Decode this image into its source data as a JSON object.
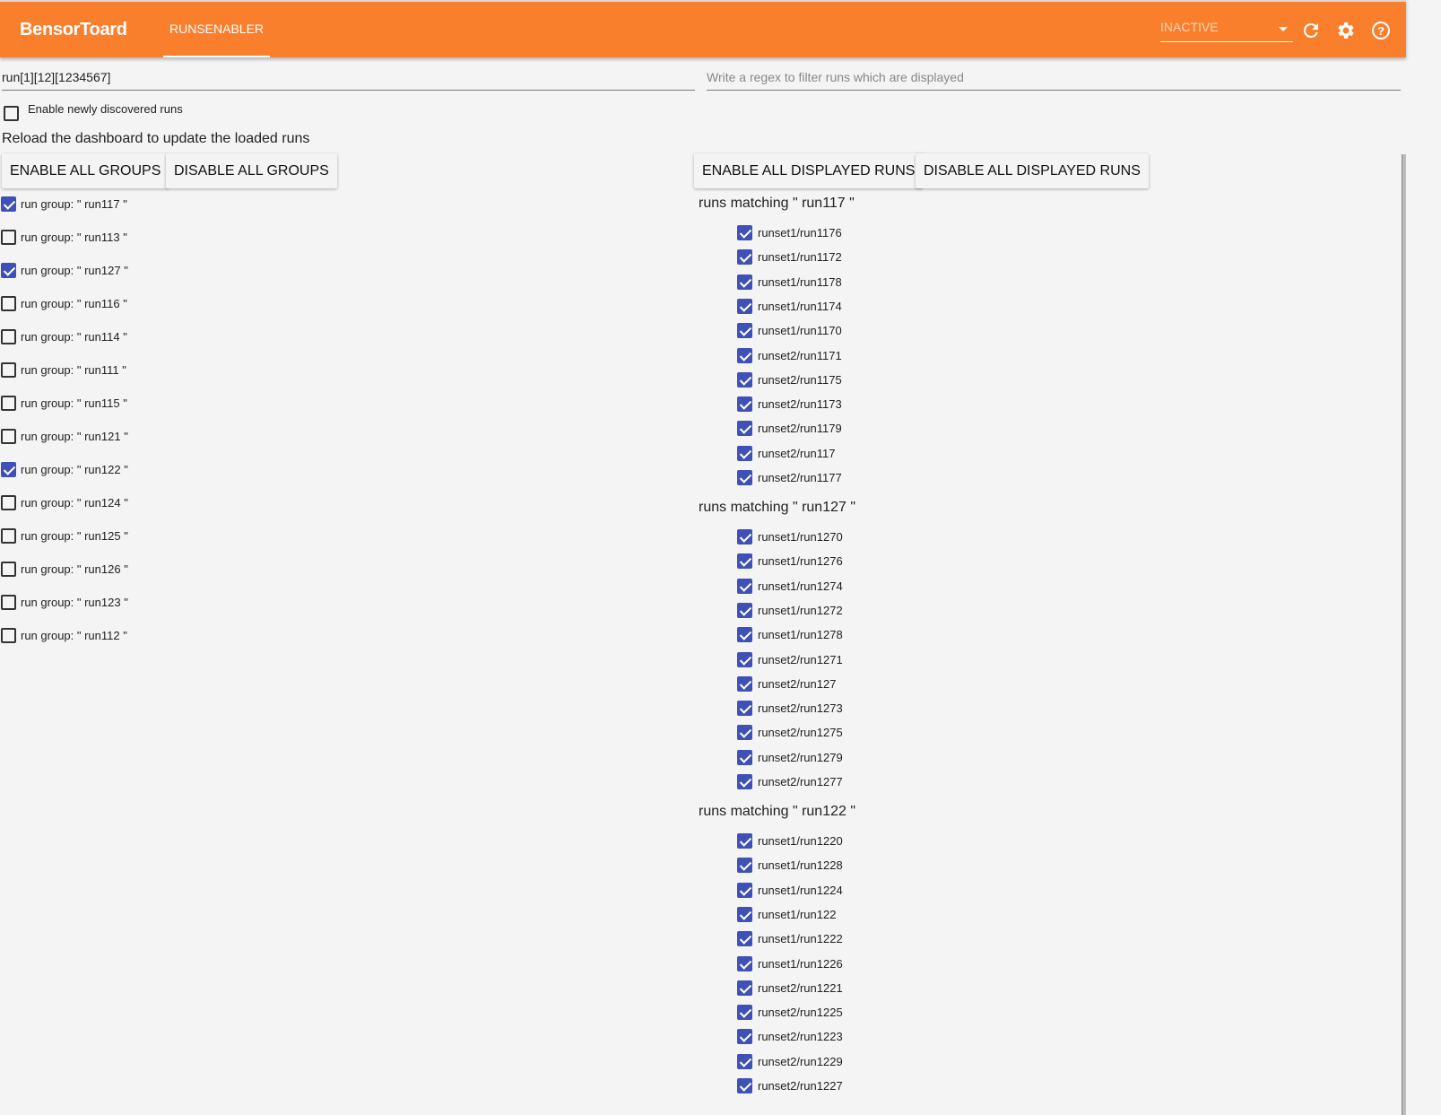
{
  "header": {
    "brand": "BensorToard",
    "tab": "RUNSENABLER",
    "status_select": "INACTIVE"
  },
  "filters": {
    "group_regex_value": "run[1][12][1234567]",
    "run_regex_placeholder": "Write a regex to filter runs which are displayed"
  },
  "enable_new_label": "Enable newly discovered runs",
  "reload_note": "Reload the dashboard to update the loaded runs",
  "buttons": {
    "enable_groups": "ENABLE ALL GROUPS",
    "disable_groups": "DISABLE ALL GROUPS",
    "enable_runs": "ENABLE ALL DISPLAYED RUNS",
    "disable_runs": "DISABLE ALL DISPLAYED RUNS"
  },
  "groups": [
    {
      "label": "run group: \" run117 \"",
      "checked": true
    },
    {
      "label": "run group: \" run113 \"",
      "checked": false
    },
    {
      "label": "run group: \" run127 \"",
      "checked": true
    },
    {
      "label": "run group: \" run116 \"",
      "checked": false
    },
    {
      "label": "run group: \" run114 \"",
      "checked": false
    },
    {
      "label": "run group: \" run111 \"",
      "checked": false
    },
    {
      "label": "run group: \" run115 \"",
      "checked": false
    },
    {
      "label": "run group: \" run121 \"",
      "checked": false
    },
    {
      "label": "run group: \" run122 \"",
      "checked": true
    },
    {
      "label": "run group: \" run124 \"",
      "checked": false
    },
    {
      "label": "run group: \" run125 \"",
      "checked": false
    },
    {
      "label": "run group: \" run126 \"",
      "checked": false
    },
    {
      "label": "run group: \" run123 \"",
      "checked": false
    },
    {
      "label": "run group: \" run112 \"",
      "checked": false
    }
  ],
  "run_sections": [
    {
      "heading": "runs matching \" run117 \"",
      "runs": [
        "runset1/run1176",
        "runset1/run1172",
        "runset1/run1178",
        "runset1/run1174",
        "runset1/run1170",
        "runset2/run1171",
        "runset2/run1175",
        "runset2/run1173",
        "runset2/run1179",
        "runset2/run117",
        "runset2/run1177"
      ]
    },
    {
      "heading": "runs matching \" run127 \"",
      "runs": [
        "runset1/run1270",
        "runset1/run1276",
        "runset1/run1274",
        "runset1/run1272",
        "runset1/run1278",
        "runset2/run1271",
        "runset2/run127",
        "runset2/run1273",
        "runset2/run1275",
        "runset2/run1279",
        "runset2/run1277"
      ]
    },
    {
      "heading": "runs matching \" run122 \"",
      "runs": [
        "runset1/run1220",
        "runset1/run1228",
        "runset1/run1224",
        "runset1/run122",
        "runset1/run1222",
        "runset1/run1226",
        "runset2/run1221",
        "runset2/run1225",
        "runset2/run1223",
        "runset2/run1229",
        "runset2/run1227"
      ]
    }
  ]
}
